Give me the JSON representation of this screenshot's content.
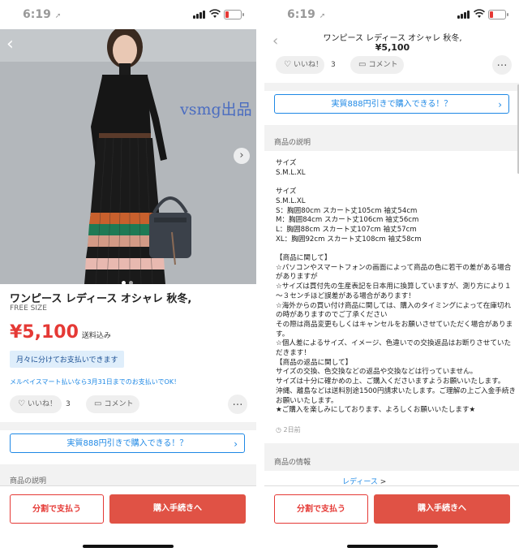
{
  "status": {
    "time": "6:19",
    "arrow": "➚"
  },
  "product": {
    "title": "ワンピース レディース オシャレ 秋冬,",
    "size": "FREE SIZE",
    "price": "¥5,100",
    "price_tax": "送料込み",
    "installment": "月々に分けてお支払いできます",
    "promo": "メルペイスマート払いなら3月31日までのお支払いでOK！",
    "watermark": "vsmg出品"
  },
  "actions": {
    "like_label": "いいね！",
    "like_count": "3",
    "comment_label": "コメント",
    "more": "…"
  },
  "cta": {
    "label": "実質888円引きで購入できる！？",
    "chevron": "›"
  },
  "sections": {
    "description": "商品の説明",
    "info": "商品の情報"
  },
  "description_text": "サイズ\nS.M.L.XL\n\nサイズ\nS.M.L.XL\nS：胸囲80cm スカート丈105cm 袖丈54cm\nM：胸囲84cm スカート丈106cm 袖丈56cm\nL：胸囲88cm スカート丈107cm 袖丈57cm\nXL：胸囲92cm スカート丈108cm 袖丈58cm\n\n【商品に関して】\n☆パソコンやスマートフォンの画面によって商品の色に若干の差がある場合がありますが\n☆サイズは買付先の生産表記を日本用に換算していますが、測り方により１～３センチほど誤差がある場合があります！\n☆海外からの買い付け商品に関しては、購入のタイミングによって在庫切れの時がありますのでご了承ください\nその際は商品変更もしくはキャンセルをお願いさせていただく場合があります。\n☆個人差によるサイズ、イメージ、色違いでの交換返品はお断りさせていただきます！\n【商品の返品に関して】\nサイズの交換、色交換などの返品や交換などは行っていません。\nサイズは十分に確かめの上、ご購入くださいますようお願いいたします。\n沖縄、離島などは送料別途1500円請求いたします。ご理解の上ご入金手続きお願いいたします。\n★ご購入を楽しみにしております、よろしくお願いいたします★",
  "posted": "2日前",
  "category": {
    "label": "レディース",
    "gt": ">"
  },
  "header": {
    "title": "ワンピース レディース オシャレ 秋冬,",
    "price": "¥5,100"
  },
  "footer": {
    "split_label": "分割で支払う",
    "buy_label": "購入手続きへ"
  },
  "colors": {
    "price": "#e53935",
    "buy": "#e05245",
    "link": "#1e88e5"
  },
  "icons": {
    "back": "chevron-left-icon",
    "next": "chevron-right-icon",
    "like": "heart-icon",
    "comment": "speech-bubble-icon",
    "clock": "clock-icon"
  }
}
